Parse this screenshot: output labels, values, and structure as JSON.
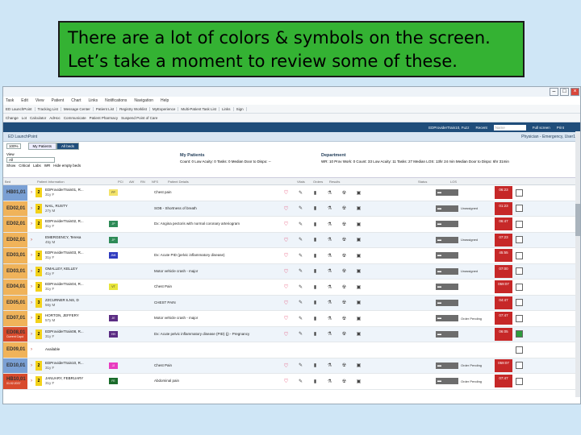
{
  "callout": {
    "line1": "There are a lot of colors & symbols on the screen.",
    "line2": "Let’s take a moment to review some of these."
  },
  "menus": [
    "Task",
    "Edit",
    "View",
    "Patient",
    "Chart",
    "Links",
    "Notifications",
    "Navigation",
    "Help"
  ],
  "toolbar": [
    "ED LaunchPoint",
    "Tracking List",
    "Message Center",
    "Patient List",
    "Registry Worklist",
    "MyExperience",
    "Multi-Patient Task List",
    "Links",
    "Sign"
  ],
  "toolbar2": [
    "Change",
    "Lot",
    "Calculator",
    "AdHoc",
    "Communicate",
    "Patient Pharmacy",
    "Suspend Point of Care"
  ],
  "topnav": {
    "user": "EDProviderTrain10, Fuzz",
    "recent": "Recent",
    "search": "Name",
    "full": "Full screen",
    "print": "Print"
  },
  "app": {
    "title": "ED LaunchPoint"
  },
  "controls": {
    "zoom": "100%",
    "filter": "Physician - Emergency, User1"
  },
  "tabs": {
    "mine": "My Patients",
    "all": "All beds"
  },
  "view": {
    "label": "View",
    "value": "All",
    "show": "Show",
    "opts": [
      "Critical",
      "Labs",
      "WR",
      "Hide empty beds"
    ]
  },
  "my": {
    "title": "My Patients",
    "stats": "Count: 0  Low Acuity: 0  Tasks: 0  Median Door to Dispo: --"
  },
  "dept": {
    "title": "Department",
    "stats": "WR: 10  Prov Work: 0  Count: 33  Low Acuity: 11  Tasks: 27  Median LOS: 13hr 24 min  Median Door to Dispo: 6hr 31min"
  },
  "headers": [
    "Bed",
    "Patient Information",
    "PCI",
    "AW",
    "RN",
    "NFS",
    "Patient Details",
    "Vitals",
    "Orders",
    "Results",
    "Status",
    "LOS"
  ],
  "rows": [
    {
      "bed": "HB01,01",
      "acu": "2",
      "name": "EDProviderTrain01, R...",
      "demo": "31y F",
      "tag": "PP",
      "tagc": "#f3e36a",
      "cc": "Chest pain",
      "cc2": "",
      "status": "",
      "los": "06:23",
      "c": "#7aa0d4"
    },
    {
      "bed": "ED02,01",
      "acu": "2",
      "name": "NAIL, RUSTY",
      "demo": "27y M",
      "tag": "",
      "tagc": "",
      "cc": "SOB - Shortness of breath",
      "cc2": "",
      "status": "Unassigned",
      "los": "01:23",
      "c": "#f0b35a"
    },
    {
      "bed": "ED02,01",
      "acu": "2",
      "name": "EDProviderTrain02, R...",
      "demo": "31y F",
      "tag": "JP",
      "tagc": "#2e8b57",
      "cc": "Dx: Angina pectoris with normal coronary arteriogram",
      "cc2": "",
      "status": "",
      "los": "06:47",
      "c": "#f0b35a"
    },
    {
      "bed": "ED02,01",
      "acu": "",
      "name": "EMERGENCY, Teresa",
      "demo": "45y M",
      "tag": "JP",
      "tagc": "#2e8b57",
      "cc": "",
      "cc2": "",
      "status": "Unassigned",
      "los": "07:23",
      "c": "#f0b35a"
    },
    {
      "bed": "ED03,01",
      "acu": "2",
      "name": "EDProviderTrain03, R...",
      "demo": "31y F",
      "tag": "JNK",
      "tagc": "#2f3bbf",
      "cc": "Dx: Acute PID (pelvic inflammatory disease)",
      "cc2": "",
      "status": "",
      "los": "45:55",
      "c": "#f0b35a"
    },
    {
      "bed": "ED03,01",
      "acu": "2",
      "name": "OMALLEY, KELLEY",
      "demo": "41y F",
      "tag": "",
      "tagc": "",
      "cc": "Motor vehicle crash - major",
      "cc2": "",
      "status": "Unassigned",
      "los": "07:00",
      "c": "#f0b35a"
    },
    {
      "bed": "ED04,01",
      "acu": "2",
      "name": "EDProviderTrain04, R...",
      "demo": "31y F",
      "tag": "VT",
      "tagc": "#e7e53b",
      "cc": "Chest Pain",
      "cc2": "",
      "status": "",
      "los": "059:07",
      "c": "#f0b35a"
    },
    {
      "bed": "ED05,01",
      "acu": "3",
      "name": "ZZCURNER ILNS, D",
      "demo": "56y M",
      "tag": "",
      "tagc": "",
      "cc": "CHEST PAIN",
      "cc2": "",
      "status": "",
      "los": "04:47",
      "c": "#f0b35a"
    },
    {
      "bed": "ED07,01",
      "acu": "2",
      "name": "HORTON, JEFFERY",
      "demo": "57y M",
      "tag": "JE",
      "tagc": "#5b2c83",
      "cc": "Motor vehicle crash - major",
      "cc2": "",
      "status": "Order Pending",
      "los": "07:47",
      "c": "#f0b35a"
    },
    {
      "bed": "ED08,01",
      "acu": "2",
      "name": "EDProviderTrain08, R...",
      "demo": "31y F",
      "tag": "HH",
      "tagc": "#5b2c83",
      "cc": "Dx: Acute pelvic inflammatory disease (PID) (j) - Pregnancy",
      "cc2": "",
      "status": "",
      "los": "06:05",
      "c": "#d84a2c",
      "sub": "Current Capd"
    },
    {
      "bed": "ED09,01",
      "acu": "",
      "name": "Available",
      "demo": "",
      "tag": "",
      "tagc": "",
      "cc": "",
      "cc2": "",
      "status": "",
      "los": "",
      "c": "#f0b35a"
    },
    {
      "bed": "ED10,01",
      "acu": "2",
      "name": "EDProviderTrain10, R...",
      "demo": "31y F",
      "tag": "JJ",
      "tagc": "#e83bbf",
      "cc": "Chest Pain",
      "cc2": "",
      "status": "Order Pending",
      "los": "059:07",
      "c": "#7aa0d4"
    },
    {
      "bed": "HB10,01",
      "acu": "2",
      "name": "JANUARY, FEBRUARY",
      "demo": "31y F",
      "tag": "FE",
      "tagc": "#1a6b2a",
      "cc": "Abdominal pain",
      "cc2": "",
      "status": "Order Pending",
      "los": "07:47",
      "c": "#d84a2c",
      "sub": "01:02:2037"
    }
  ]
}
